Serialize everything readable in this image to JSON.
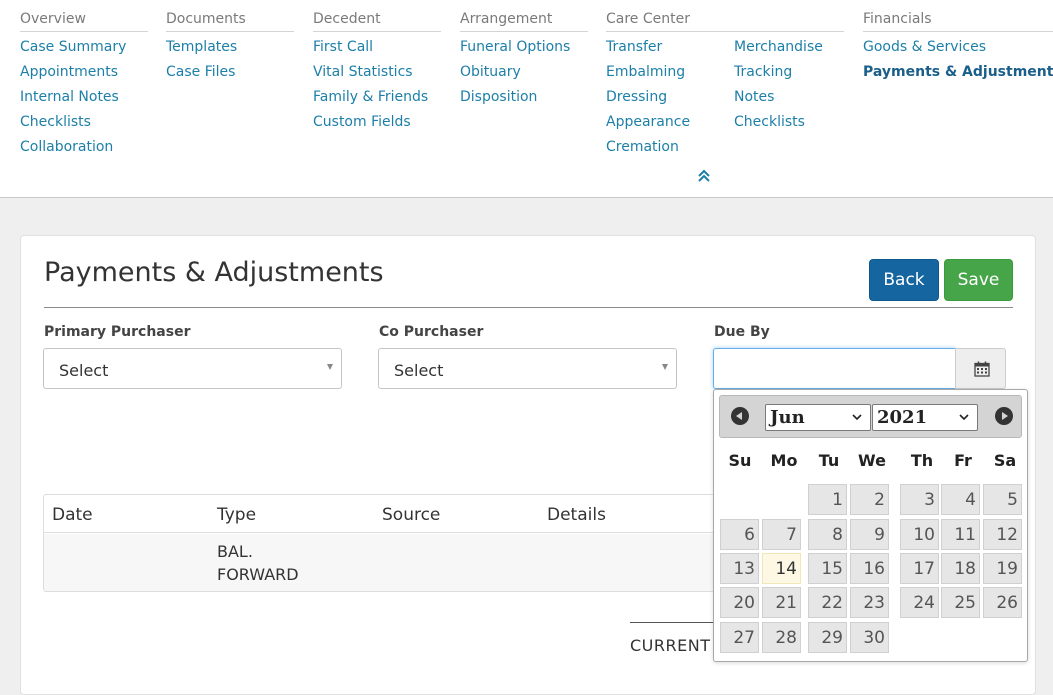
{
  "nav": {
    "columns": [
      {
        "heading": "Overview",
        "links": [
          "Case Summary",
          "Appointments",
          "Internal Notes",
          "Checklists",
          "Collaboration"
        ]
      },
      {
        "heading": "Documents",
        "links": [
          "Templates",
          "Case Files"
        ]
      },
      {
        "heading": "Decedent",
        "links": [
          "First Call",
          "Vital Statistics",
          "Family & Friends",
          "Custom Fields"
        ]
      },
      {
        "heading": "Arrangement",
        "links": [
          "Funeral Options",
          "Obituary",
          "Disposition"
        ]
      },
      {
        "heading": "Care Center",
        "links": [
          "Transfer",
          "Embalming",
          "Dressing",
          "Appearance",
          "Cremation"
        ],
        "links2": [
          "Merchandise",
          "Tracking",
          "Notes",
          "Checklists"
        ]
      },
      {
        "heading": "Financials",
        "links": [
          "Goods & Services",
          "Payments & Adjustments"
        ]
      }
    ],
    "active_link": "Payments & Adjustments",
    "collapse_icon": "double-chevron-up-icon"
  },
  "page": {
    "title": "Payments & Adjustments",
    "back_label": "Back",
    "save_label": "Save"
  },
  "form": {
    "primary_purchaser": {
      "label": "Primary Purchaser",
      "value": "Select"
    },
    "co_purchaser": {
      "label": "Co Purchaser",
      "value": "Select"
    },
    "due_by": {
      "label": "Due By",
      "value": "",
      "icon": "calendar-icon"
    }
  },
  "table": {
    "headers": [
      "Date",
      "Type",
      "Source",
      "Details"
    ],
    "rows": [
      {
        "date": "",
        "type": "BAL. FORWARD",
        "source": "",
        "details": ""
      }
    ]
  },
  "summary": {
    "current_label": "CURRENT"
  },
  "datepicker": {
    "month": "Jun",
    "year": "2021",
    "weekdays": [
      "Su",
      "Mo",
      "Tu",
      "We",
      "Th",
      "Fr",
      "Sa"
    ],
    "first_weekday_index": 2,
    "days_in_month": 30,
    "today": 14
  },
  "colors": {
    "link": "#1d7fa8",
    "back_button": "#1565a0",
    "save_button": "#45a548",
    "today_highlight": "#fcf8e3"
  }
}
